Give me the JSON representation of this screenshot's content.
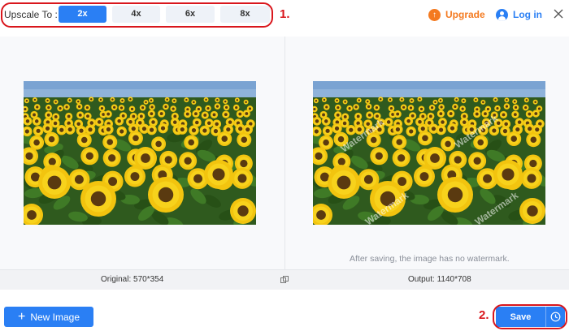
{
  "toolbar": {
    "upscale_label": "Upscale To :",
    "scales": [
      {
        "label": "2x",
        "active": true
      },
      {
        "label": "4x",
        "active": false
      },
      {
        "label": "6x",
        "active": false
      },
      {
        "label": "8x",
        "active": false
      }
    ],
    "annotation_1": "1.",
    "upgrade_label": "Upgrade",
    "login_label": "Log in"
  },
  "preview": {
    "original_caption": "Original: 570*354",
    "output_caption": "Output: 1140*708",
    "watermark_text": "Watermark",
    "note": "After saving, the image has no watermark."
  },
  "footer": {
    "new_image_label": "New Image",
    "save_label": "Save",
    "annotation_2": "2."
  },
  "colors": {
    "accent": "#2a7ff4",
    "upgrade": "#f47a20",
    "annotation": "#d9161c"
  },
  "icons": {
    "upgrade": "arrow-up-circle-icon",
    "login": "user-circle-icon",
    "close": "close-icon",
    "compare": "compare-icon",
    "new_image": "plus-icon",
    "save_history": "clock-icon"
  }
}
